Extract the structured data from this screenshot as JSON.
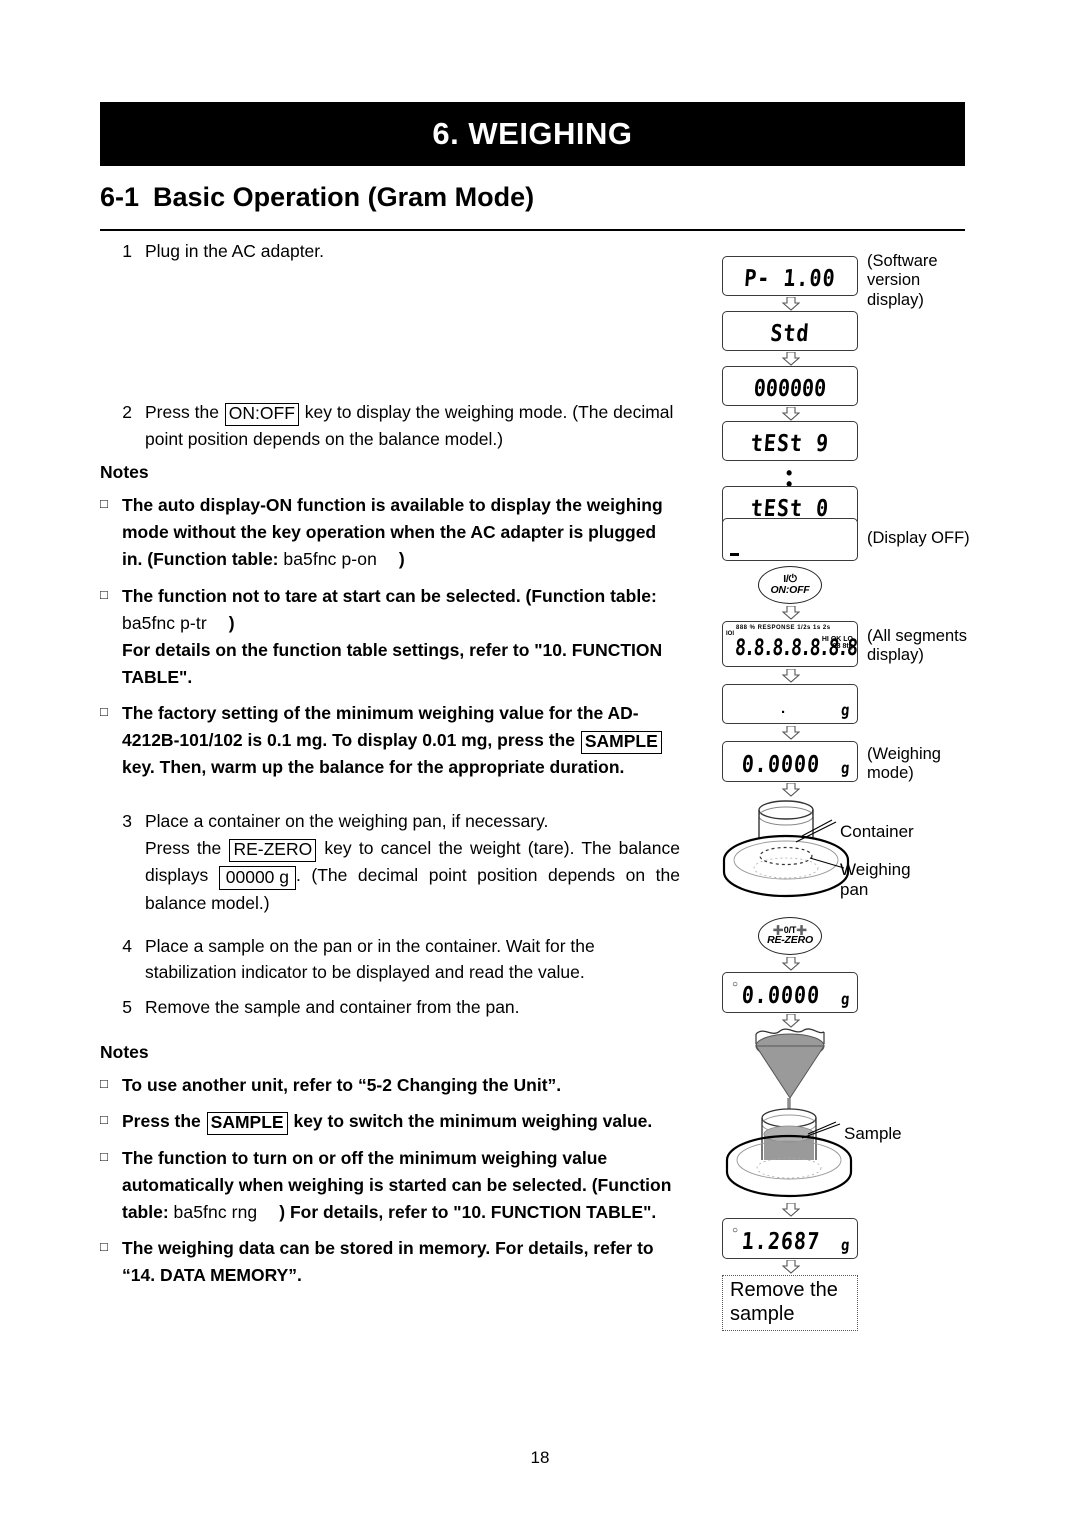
{
  "header": {
    "chapter": "6.  WEIGHING",
    "section_number": "6-1",
    "section_title": "Basic Operation (Gram Mode)"
  },
  "steps": [
    {
      "n": "1",
      "text": "Plug in the AC adapter."
    },
    {
      "n": "2",
      "pre": "Press the ",
      "key": "ON:OFF",
      "post": " key to display the weighing mode. (The decimal point position depends on the balance model.)"
    },
    {
      "n": "3",
      "line1": "Place a container on the weighing pan, if necessary.",
      "pre2": "Press the ",
      "key2": "RE-ZERO",
      "mid2": " key to cancel the weight (tare). The balance displays ",
      "disp2": "00000 g",
      "post2": ". (The decimal point position depends on the balance model.)"
    },
    {
      "n": "4",
      "text": "Place a sample on the pan or in the container. Wait for the stabilization indicator to be displayed and read the value."
    },
    {
      "n": "5",
      "text": "Remove the sample and container from the pan."
    }
  ],
  "notes_title": "Notes",
  "notes_upper": [
    {
      "text_a": "The auto display-ON function is available to display the weighing mode without the key operation when the AC adapter is plugged in. (Function table: ",
      "fnref": "ba5fnc p-on",
      "text_b": ")"
    },
    {
      "text_a": "The function not to tare at start can be selected. (Function table: ",
      "fnref": "ba5fnc p-tr",
      "text_b": ")",
      "text_c": "For details on the function table settings, refer to \"10. FUNCTION TABLE\"."
    },
    {
      "text_a": "The factory setting of the minimum weighing value for the AD-4212B-101/102 is 0.1 mg. To display 0.01 mg, press the ",
      "key": "SAMPLE",
      "text_b": " key. Then, warm up the balance for the appropriate duration."
    }
  ],
  "notes_lower": [
    {
      "text_a": "To use another unit, refer to “5-2 Changing the Unit”."
    },
    {
      "text_a": "Press the ",
      "key": "SAMPLE",
      "text_b": " key to switch the minimum weighing value."
    },
    {
      "text_a": "The function to turn on or off the minimum weighing value automatically when weighing is started can be selected. (Function table: ",
      "fnref": "ba5fnc rng",
      "text_b": ") For details, refer to \"10. FUNCTION TABLE\"."
    },
    {
      "text_a": "The weighing data can be stored in memory. For details, refer to “14. DATA MEMORY”."
    }
  ],
  "diagram": {
    "displays": {
      "software_version": "P- 1.00",
      "std": "Std",
      "zeros": "000000",
      "test9": "tESt 9",
      "test0": "tESt 0",
      "display_off": "",
      "all_segments": "8.8.8.8.8.8.8.8",
      "blank_unit": "g",
      "weighing_mode": "0.0000",
      "weighing_mode_unit": "g",
      "rezero_value": "0.0000",
      "rezero_unit": "g",
      "sample_value": "1.2687",
      "sample_unit": "g"
    },
    "all_segments_marks": {
      "top_row": "888 %  RESPONSE  1/2s  1s  2s",
      "right_top": "HI OK LO",
      "right_block": "88 8",
      "right_unit": "tg",
      "left_marks": "IOI"
    },
    "captions": {
      "software_version": "(Software\nversion\ndisplay)",
      "display_off": "(Display OFF)",
      "all_segments": "(All segments\ndisplay)",
      "weighing_mode": "(Weighing\nmode)",
      "container": "Container",
      "weighing_pan": "Weighing\npan",
      "sample": "Sample",
      "remove_the_sample": "Remove the\nsample"
    },
    "keys": {
      "onoff_top": "I/⏻",
      "onoff_bottom": "ON:OFF",
      "rezero_top": "➕0/T➕",
      "rezero_bottom": "RE-ZERO"
    },
    "ellipsis": "•\n•"
  },
  "page_number": "18",
  "colors": {
    "banner_bg": "#000000",
    "banner_fg": "#ffffff",
    "lcd_border": "#3a3a3a",
    "sample_fill": "#9a9a9a"
  }
}
